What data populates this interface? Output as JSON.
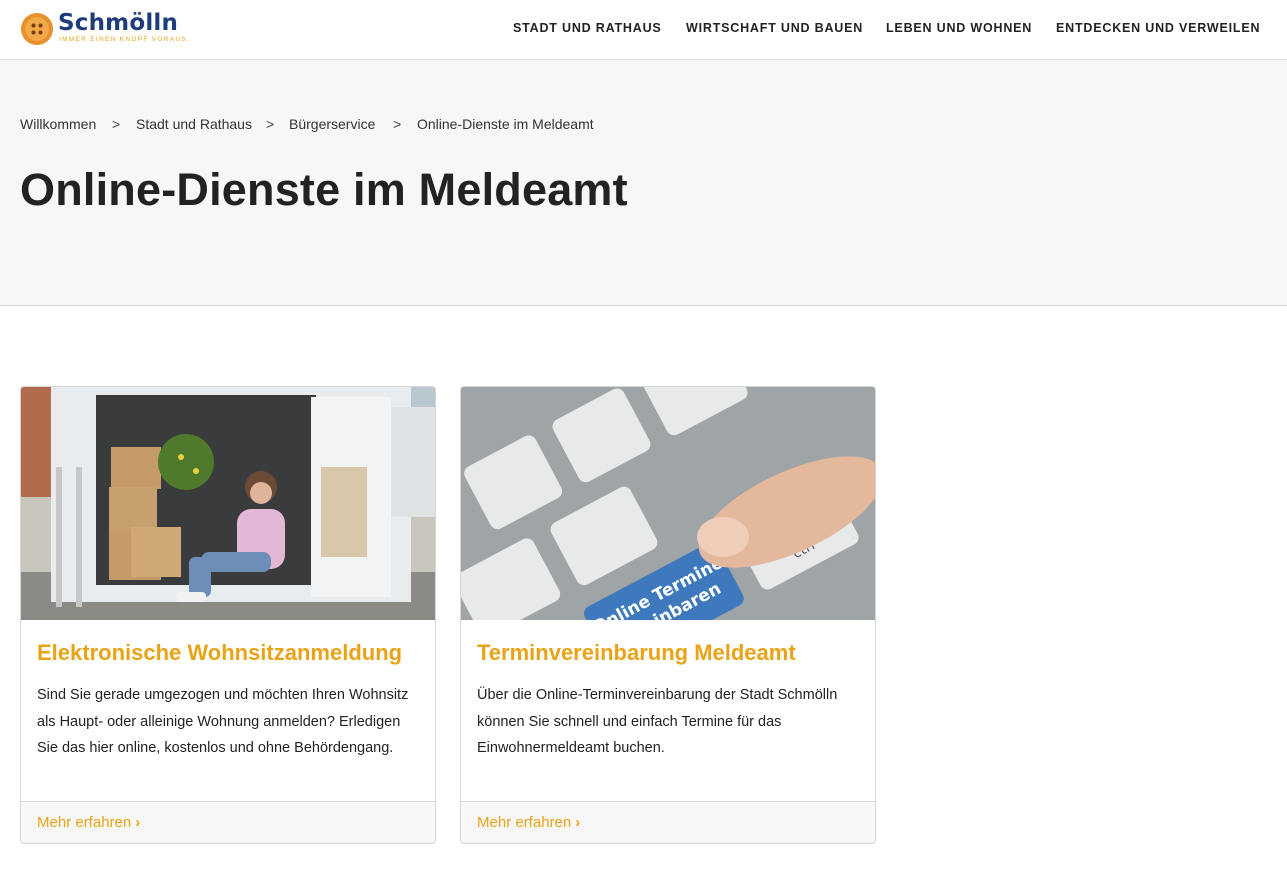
{
  "header": {
    "logo": {
      "name": "Schmölln",
      "tagline": "IMMER EINEN KNOPF VORAUS."
    },
    "nav": [
      {
        "label": "STADT UND RATHAUS"
      },
      {
        "label": "WIRTSCHAFT UND BAUEN"
      },
      {
        "label": "LEBEN UND WOHNEN"
      },
      {
        "label": "ENTDECKEN UND VERWEILEN"
      }
    ]
  },
  "breadcrumb": {
    "items": [
      {
        "label": "Willkommen"
      },
      {
        "label": "Stadt und Rathaus"
      },
      {
        "label": "Bürgerservice"
      },
      {
        "label": "Online-Dienste im Meldeamt"
      }
    ],
    "separator": ">"
  },
  "page": {
    "title": "Online-Dienste im Meldeamt"
  },
  "cards": [
    {
      "image_icon": "moving-van-photo",
      "title": "Elektronische Wohnsitzanmeldung",
      "text": "Sind Sie gerade umgezogen und möchten Ihren Wohnsitz als Haupt- oder alleinige Wohnung anmelden? Erledigen Sie das hier online, kostenlos und ohne Behördengang.",
      "link": "Mehr erfahren"
    },
    {
      "image_icon": "keyboard-key-photo",
      "image_text": [
        "Online Termine",
        "vereinbaren"
      ],
      "image_key_labels": [
        "ctrl"
      ],
      "title": "Terminvereinbarung Meldeamt",
      "text": "Über die Online-Terminvereinbarung der Stadt Schmölln können Sie schnell und einfach Termine für das Einwohnermeldeamt buchen.",
      "link": "Mehr erfahren"
    }
  ],
  "colors": {
    "accent": "#e9a317",
    "brand": "#1f3c7a",
    "hero_bg": "#f7f7f7"
  }
}
